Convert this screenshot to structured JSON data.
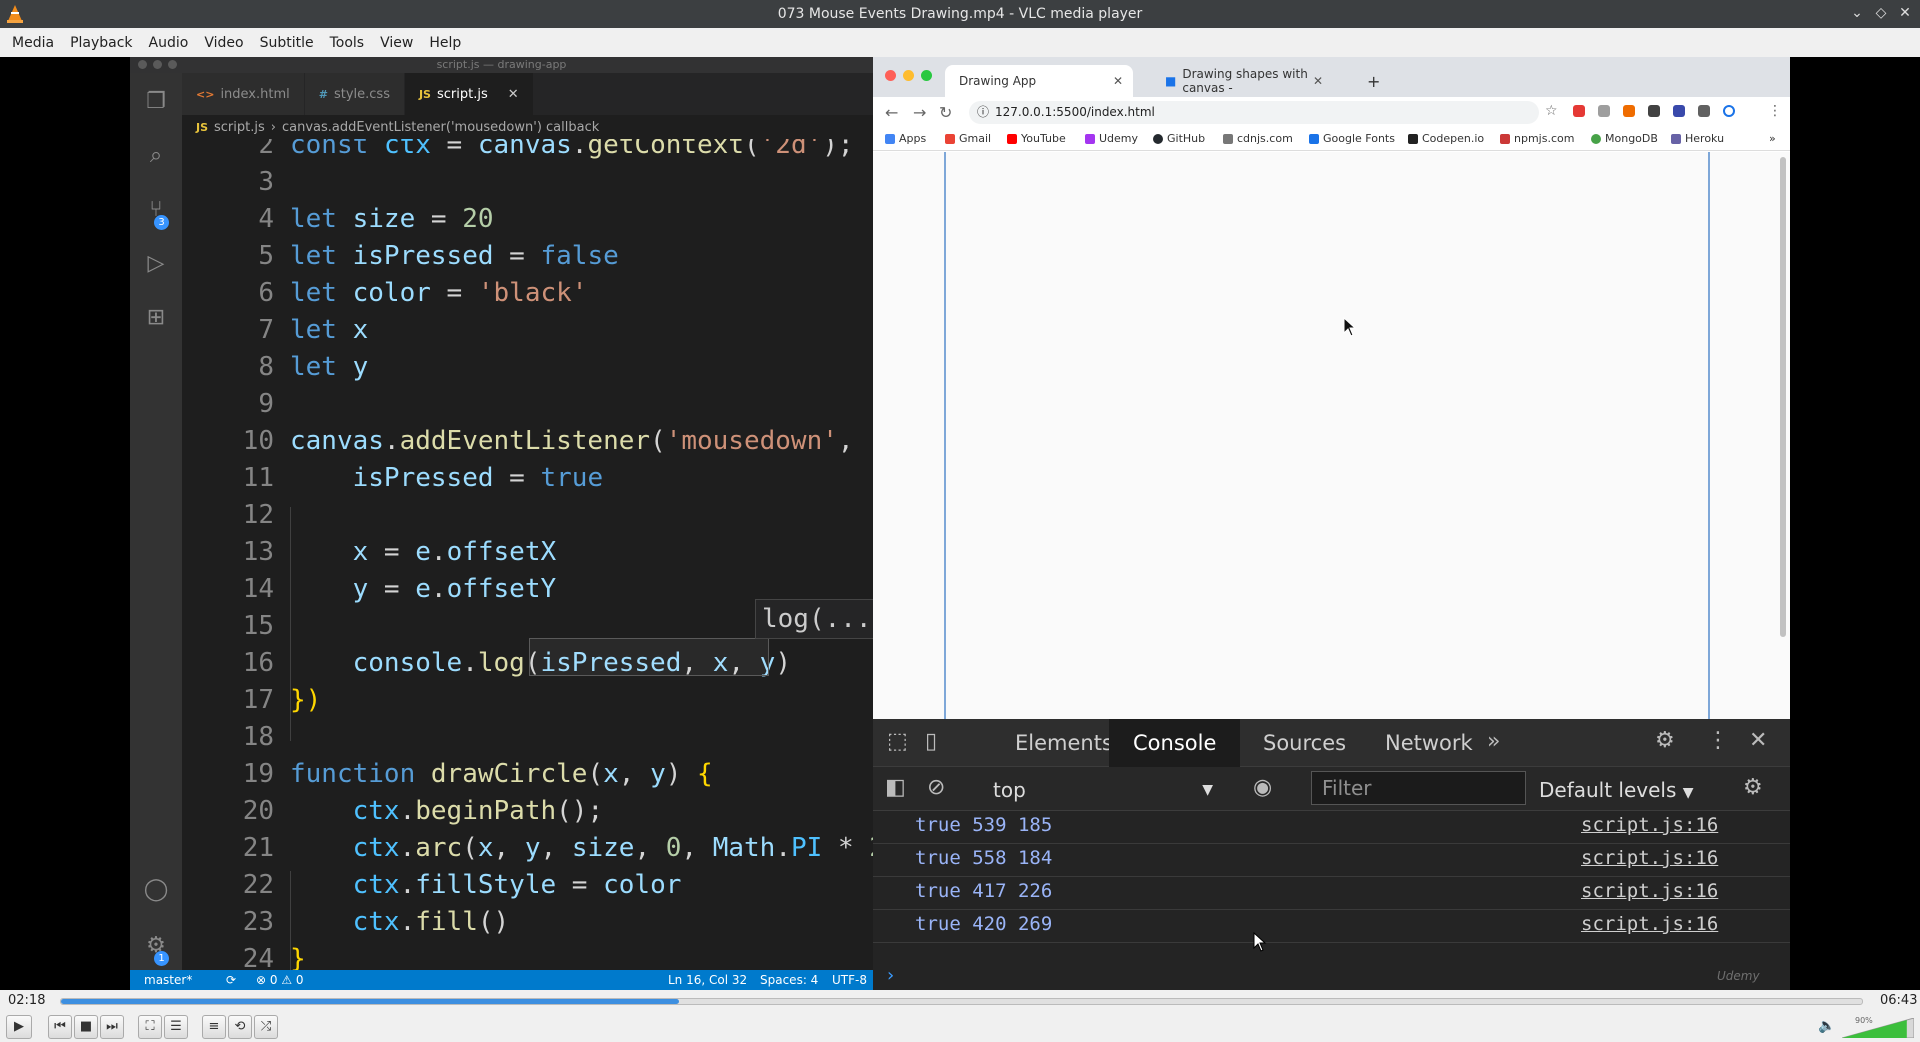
{
  "window": {
    "title": "073 Mouse Events Drawing.mp4 - VLC media player"
  },
  "menu": [
    "Media",
    "Playback",
    "Audio",
    "Video",
    "Subtitle",
    "Tools",
    "View",
    "Help"
  ],
  "vscode": {
    "window_title": "script.js — drawing-app",
    "tabs": [
      {
        "icon": "<>",
        "label": "index.html"
      },
      {
        "icon": "#",
        "label": "style.css"
      },
      {
        "icon": "JS",
        "label": "script.js"
      }
    ],
    "breadcrumb": {
      "file": "script.js",
      "symbol": "canvas.addEventListener('mousedown') callback"
    },
    "activity_badges": {
      "scm": "3",
      "settings": "1"
    },
    "tooltip": "log(...d",
    "status": {
      "branch": "master*",
      "problems": "⊗ 0 ⚠ 0",
      "position": "Ln 16, Col 32",
      "spaces": "Spaces: 4",
      "encoding": "UTF-8"
    }
  },
  "browser": {
    "tabs": [
      "Drawing App",
      "Drawing shapes with canvas -"
    ],
    "url": "127.0.0.1:5500/index.html",
    "bookmarks": [
      "Apps",
      "Gmail",
      "YouTube",
      "Udemy",
      "GitHub",
      "cdnjs.com",
      "Google Fonts",
      "Codepen.io",
      "npmjs.com",
      "MongoDB",
      "Heroku"
    ]
  },
  "devtools": {
    "tabs": [
      "Elements",
      "Console",
      "Sources",
      "Network"
    ],
    "context": "top",
    "filter_placeholder": "Filter",
    "levels": "Default levels",
    "logs": [
      {
        "value": "true 539 185",
        "source": "script.js:16"
      },
      {
        "value": "true 558 184",
        "source": "script.js:16"
      },
      {
        "value": "true 417 226",
        "source": "script.js:16"
      },
      {
        "value": "true 420 269",
        "source": "script.js:16"
      }
    ],
    "watermark": "Udemy"
  },
  "player": {
    "elapsed": "02:18",
    "total": "06:43",
    "progress": 0.343,
    "volume_label": "90%",
    "volume": 0.9
  },
  "colors": {
    "accent": "#3d8fe0",
    "vscode_status": "#007acc",
    "log_value": "#9ab4f7"
  }
}
